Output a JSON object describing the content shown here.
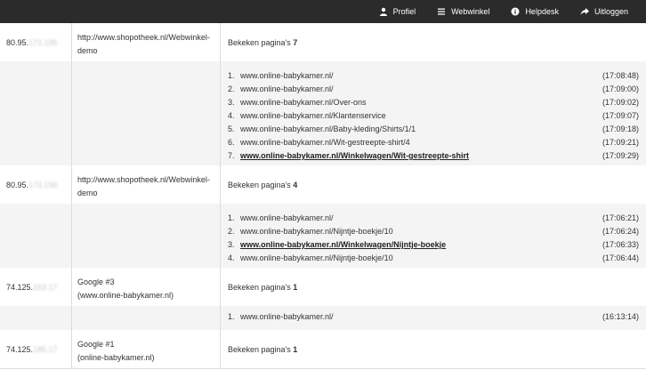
{
  "nav": {
    "profile": "Profiel",
    "webshop": "Webwinkel",
    "helpdesk": "Helpdesk",
    "logout": "Uitloggen"
  },
  "viewed_label": "Bekeken pagina's",
  "visits": [
    {
      "ip_prefix": "80.95.",
      "ip_masked": "173.195",
      "source": "http://www.shopotheek.nl/Webwinkel-demo",
      "source_sub": "",
      "count": "7",
      "pages": [
        {
          "n": "1.",
          "url": "www.online-babykamer.nl/",
          "time": "(17:08:48)"
        },
        {
          "n": "2.",
          "url": "www.online-babykamer.nl/",
          "time": "(17:09:00)"
        },
        {
          "n": "3.",
          "url": "www.online-babykamer.nl/Over-ons",
          "time": "(17:09:02)"
        },
        {
          "n": "4.",
          "url": "www.online-babykamer.nl/Klantenservice",
          "time": "(17:09:07)"
        },
        {
          "n": "5.",
          "url": "www.online-babykamer.nl/Baby-kleding/Shirts/1/1",
          "time": "(17:09:18)"
        },
        {
          "n": "6.",
          "url": "www.online-babykamer.nl/Wit-gestreepte-shirt/4",
          "time": "(17:09:21)"
        },
        {
          "n": "7.",
          "url": "www.online-babykamer.nl/Winkelwagen/Wit-gestreepte-shirt",
          "time": "(17:09:29)",
          "highlight": true
        }
      ]
    },
    {
      "ip_prefix": "80.95.",
      "ip_masked": "173.199",
      "source": "http://www.shopotheek.nl/Webwinkel-demo",
      "source_sub": "",
      "count": "4",
      "pages": [
        {
          "n": "1.",
          "url": "www.online-babykamer.nl/",
          "time": "(17:06:21)"
        },
        {
          "n": "2.",
          "url": "www.online-babykamer.nl/Nijntje-boekje/10",
          "time": "(17:06:24)"
        },
        {
          "n": "3.",
          "url": "www.online-babykamer.nl/Winkelwagen/Nijntje-boekje",
          "time": "(17:06:33)",
          "highlight": true
        },
        {
          "n": "4.",
          "url": "www.online-babykamer.nl/Nijntje-boekje/10",
          "time": "(17:06:44)"
        }
      ]
    },
    {
      "ip_prefix": "74.125.",
      "ip_masked": "163.17",
      "source": "Google #3",
      "source_sub": "(www.online-babykamer.nl)",
      "count": "1",
      "pages": [
        {
          "n": "1.",
          "url": "www.online-babykamer.nl/",
          "time": "(16:13:14)"
        }
      ]
    },
    {
      "ip_prefix": "74.125.",
      "ip_masked": "185.17",
      "source": "Google #1",
      "source_sub": "(online-babykamer.nl)",
      "count": "1",
      "pages": []
    }
  ]
}
